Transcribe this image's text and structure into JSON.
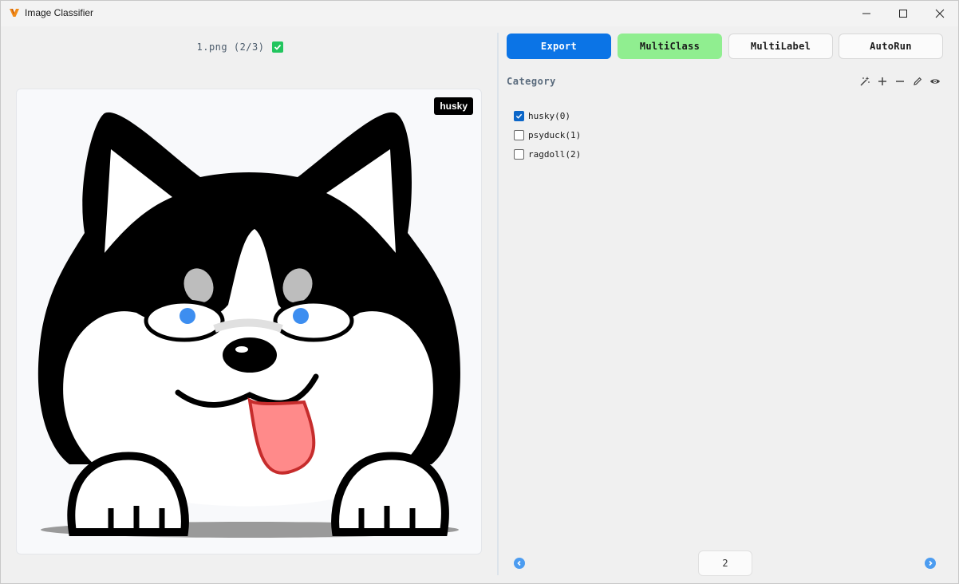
{
  "window": {
    "title": "Image Classifier"
  },
  "viewer": {
    "file_label": "1.png (2/3)",
    "prediction_badge": "husky"
  },
  "toolbar": {
    "export_label": "Export",
    "multiclass_label": "MultiClass",
    "multilabel_label": "MultiLabel",
    "autorun_label": "AutoRun"
  },
  "category": {
    "title": "Category",
    "items": [
      {
        "label": "husky(0)",
        "checked": true
      },
      {
        "label": "psyduck(1)",
        "checked": false
      },
      {
        "label": "ragdoll(2)",
        "checked": false
      }
    ]
  },
  "pager": {
    "page_value": "2"
  },
  "colors": {
    "export_bg": "#0b74e6",
    "multiclass_bg": "#90ee90",
    "checked_blue": "#0b66c8",
    "file_ok_green": "#22c55e",
    "nav_blue": "#4c9cf0"
  },
  "icons": {
    "app": "v-logo-icon",
    "file_status": "check-square-icon",
    "tools": [
      "magic-wand-icon",
      "plus-icon",
      "minus-icon",
      "pencil-icon",
      "eye-icon"
    ],
    "pager": [
      "chevron-left-circle-icon",
      "chevron-right-circle-icon"
    ]
  }
}
